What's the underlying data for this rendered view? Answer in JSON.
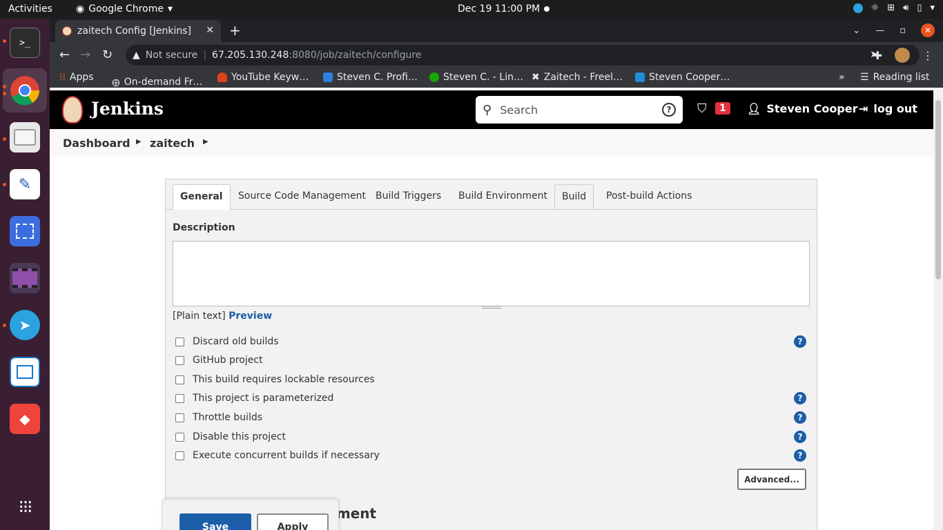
{
  "topbar": {
    "activities": "Activities",
    "app_name": "Google Chrome",
    "datetime": "Dec 19  11:00 PM"
  },
  "dock": {
    "items": [
      "terminal",
      "chrome",
      "files",
      "text-editor",
      "screenshot",
      "video",
      "telegram",
      "writer",
      "anydesk",
      "app-grid"
    ]
  },
  "browser": {
    "tab_title": "zaitech Config [Jenkins]",
    "not_secure": "Not secure",
    "url_host": "67.205.130.248",
    "url_path": ":8080/job/zaitech/configure",
    "bookmarks": [
      "Apps",
      "On-demand Fr…",
      "YouTube Keyw…",
      "Steven C. Profi…",
      "Steven C. - Lin…",
      "Zaitech - Freel…",
      "Steven Cooper…"
    ],
    "more_bookmarks": "»",
    "reading_list": "Reading list"
  },
  "jenkins": {
    "title": "Jenkins",
    "search_placeholder": "Search",
    "alert_count": "1",
    "user_name": "Steven Cooper",
    "logout": "log out",
    "breadcrumbs": [
      "Dashboard",
      "zaitech"
    ]
  },
  "config": {
    "tabs": [
      "General",
      "Source Code Management",
      "Build Triggers",
      "Build Environment",
      "Build",
      "Post-build Actions"
    ],
    "active_tab": "General",
    "description_label": "Description",
    "plain_text": "[Plain text]",
    "preview": "Preview",
    "options": [
      "Discard old builds",
      "GitHub project",
      "This build requires lockable resources",
      "This project is parameterized",
      "Throttle builds",
      "Disable this project",
      "Execute concurrent builds if necessary"
    ],
    "advanced": "Advanced...",
    "next_section": "Source Code Management",
    "save": "Save",
    "apply": "Apply"
  },
  "colors": {
    "jenkins_header": "#000000",
    "link_blue": "#1d5ea8",
    "alert_red": "#e0313c",
    "ubuntu_orange": "#e95420"
  }
}
